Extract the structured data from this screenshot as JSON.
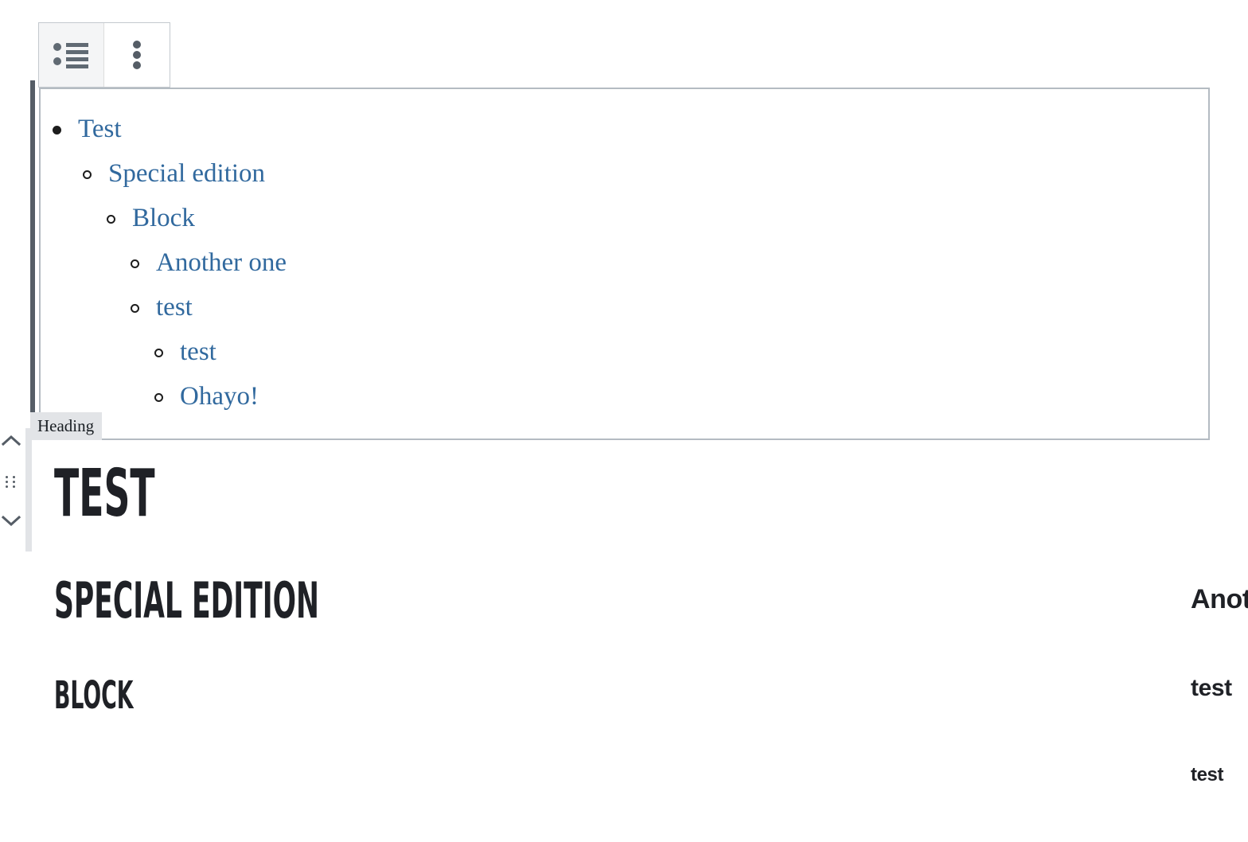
{
  "toolbar": {
    "list_button_label": "Unordered list",
    "list_icon": "unordered-list-icon",
    "options_button_label": "Options",
    "options_icon": "kebab-menu-icon"
  },
  "list_block": {
    "items": [
      {
        "text": "Test",
        "level": 1,
        "marker": "disc"
      },
      {
        "text": "Special edition",
        "level": 2,
        "marker": "circle"
      },
      {
        "text": "Block",
        "level": 3,
        "marker": "circle"
      },
      {
        "text": "Another one",
        "level": 4,
        "marker": "circle"
      },
      {
        "text": "test",
        "level": 4,
        "marker": "circle"
      },
      {
        "text": "test",
        "level": 5,
        "marker": "circle"
      },
      {
        "text": "Ohayo!",
        "level": 5,
        "marker": "circle"
      }
    ],
    "link_color": "#31699e",
    "selected_bar_color": "#555d66",
    "border_color": "#b4bbc2"
  },
  "heading_block": {
    "label": "Heading",
    "label_bg": "#e2e4e7",
    "text": "TEST",
    "mover": {
      "up_label": "Move up",
      "up_icon": "chevron-up-icon",
      "drag_label": "Drag",
      "drag_icon": "drag-handle-icon",
      "down_label": "Move down",
      "down_icon": "chevron-down-icon"
    }
  },
  "columns": {
    "left": [
      {
        "text": "SPECIAL EDITION",
        "style": "display"
      },
      {
        "text": "BLOCK",
        "style": "display"
      }
    ],
    "right": [
      {
        "text": "Another one",
        "style": "plain"
      },
      {
        "text": "test",
        "style": "plain"
      },
      {
        "text": "test",
        "style": "plain"
      }
    ]
  },
  "colors": {
    "accent": "#31699e",
    "text": "#1f2126",
    "chrome": "#555d66",
    "border": "#b4bbc2",
    "panel": "#e2e4e7"
  }
}
